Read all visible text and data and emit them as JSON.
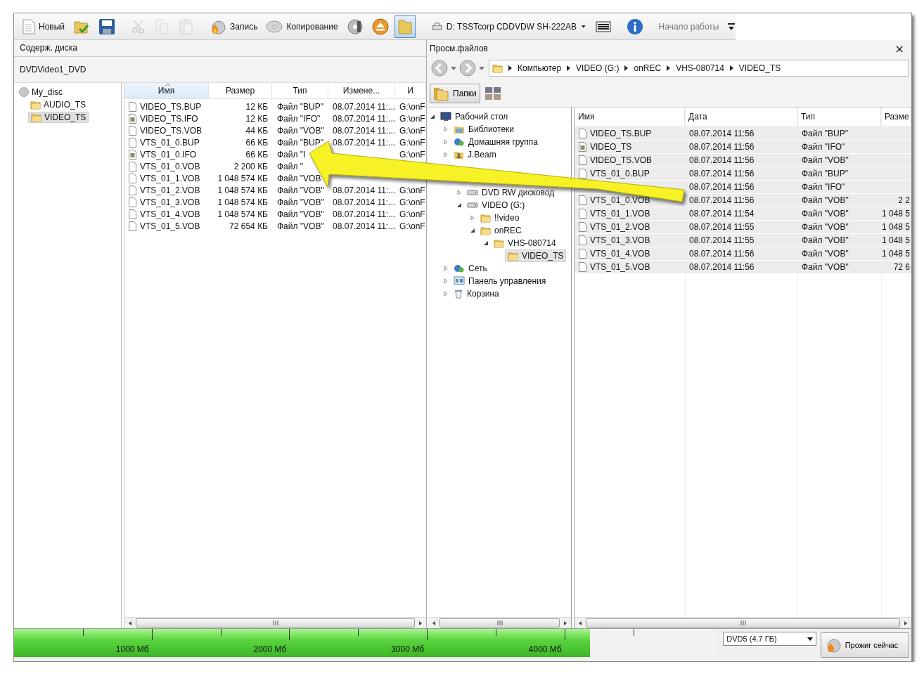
{
  "toolbar": {
    "items": [
      {
        "kind": "new",
        "label": "Новый",
        "disabled": false,
        "pressed": false
      },
      {
        "kind": "open",
        "disabled": false,
        "pressed": false
      },
      {
        "kind": "save",
        "disabled": false,
        "pressed": false
      },
      {
        "kind": "separator"
      },
      {
        "kind": "cut",
        "disabled": true,
        "pressed": false
      },
      {
        "kind": "copy",
        "disabled": true,
        "pressed": false
      },
      {
        "kind": "paste",
        "disabled": true,
        "pressed": false
      },
      {
        "kind": "separator"
      },
      {
        "kind": "burn",
        "label": "Запись",
        "disabled": false,
        "pressed": false
      },
      {
        "kind": "disc",
        "label": "Копирование",
        "disabled": false,
        "pressed": false
      },
      {
        "kind": "discinfo",
        "disabled": false,
        "pressed": false
      },
      {
        "kind": "eject",
        "disabled": false,
        "pressed": false
      },
      {
        "kind": "browser",
        "disabled": false,
        "pressed": true
      },
      {
        "kind": "separator"
      },
      {
        "kind": "drive",
        "label": "D: TSSTcorp CDDVDW SH-222AB"
      },
      {
        "kind": "list",
        "disabled": false,
        "pressed": false
      },
      {
        "kind": "separator"
      },
      {
        "kind": "info",
        "disabled": false,
        "pressed": false
      },
      {
        "kind": "separator"
      },
      {
        "kind": "start",
        "label": "Начало работы",
        "disabled": true,
        "pressed": false
      },
      {
        "kind": "overflow",
        "disabled": false,
        "pressed": false
      }
    ]
  },
  "disc_pane": {
    "title": "Содерж. диска",
    "project": "DVDVideo1_DVD",
    "tree": [
      {
        "label": "My_disc",
        "kind": "disc",
        "selected": false,
        "children": [
          {
            "label": "AUDIO_TS",
            "kind": "folder",
            "selected": false
          },
          {
            "label": "VIDEO_TS",
            "kind": "folder",
            "selected": true
          }
        ]
      }
    ],
    "table": {
      "columns": [
        {
          "label": "Имя",
          "sorted": true
        },
        {
          "label": "Размер",
          "sorted": false
        },
        {
          "label": "Тип",
          "sorted": false
        },
        {
          "label": "Измене...",
          "sorted": false
        },
        {
          "label": "И",
          "sorted": false
        }
      ],
      "rows": [
        {
          "kind": "file",
          "name": "VIDEO_TS.BUP",
          "size": "12 КБ",
          "type": "Файл \"BUP\"",
          "date": "08.07.2014 11:...",
          "path": "G:\\onF"
        },
        {
          "kind": "ifo",
          "name": "VIDEO_TS.IFO",
          "size": "12 КБ",
          "type": "Файл \"IFO\"",
          "date": "08.07.2014 11:...",
          "path": "G:\\onF"
        },
        {
          "kind": "file",
          "name": "VIDEO_TS.VOB",
          "size": "44 КБ",
          "type": "Файл \"VOB\"",
          "date": "08.07.2014 11:...",
          "path": "G:\\onF"
        },
        {
          "kind": "file",
          "name": "VTS_01_0.BUP",
          "size": "66 КБ",
          "type": "Файл \"BUP\"",
          "date": "08.07.2014 11:...",
          "path": "G:\\onF"
        },
        {
          "kind": "ifo",
          "name": "VTS_01_0.IFO",
          "size": "66 КБ",
          "type": "Файл \"I",
          "path": "G:\\onF"
        },
        {
          "kind": "file",
          "name": "VTS_01_0.VOB",
          "size": "2 200 КБ",
          "type": "Файл \""
        },
        {
          "kind": "file",
          "name": "VTS_01_1.VOB",
          "size": "1 048 574 КБ",
          "type": "Файл \"VOB"
        },
        {
          "kind": "file",
          "name": "VTS_01_2.VOB",
          "size": "1 048 574 КБ",
          "type": "Файл \"VOB\"",
          "date": "08.07.2014 11:...",
          "path": "G:\\onF"
        },
        {
          "kind": "file",
          "name": "VTS_01_3.VOB",
          "size": "1 048 574 КБ",
          "type": "Файл \"VOB\"",
          "date": "08.07.2014 11:...",
          "path": "G:\\onF"
        },
        {
          "kind": "file",
          "name": "VTS_01_4.VOB",
          "size": "1 048 574 КБ",
          "type": "Файл \"VOB\"",
          "date": "08.07.2014 11:...",
          "path": "G:\\onF"
        },
        {
          "kind": "file",
          "name": "VTS_01_5.VOB",
          "size": "72 654 КБ",
          "type": "Файл \"VOB\"",
          "date": "08.07.2014 11:...",
          "path": "G:\\onF"
        }
      ]
    }
  },
  "browser": {
    "title": "Просм.файлов",
    "close": "×",
    "path": [
      "Компьютер",
      "VIDEO (G:)",
      "onREC",
      "VHS-080714",
      "VIDEO_TS"
    ],
    "folders_button": {
      "label": "Папки",
      "pressed": true
    },
    "tree": [
      {
        "label": "Рабочий стол",
        "kind": "desktop",
        "expanded": true,
        "selected": false,
        "children": [
          {
            "label": "Библиотеки",
            "kind": "library",
            "expanded": false,
            "selected": false
          },
          {
            "label": "Домашняя группа",
            "kind": "network",
            "expanded": false,
            "selected": false
          },
          {
            "label": "J.Beam",
            "kind": "user",
            "expanded": false,
            "selected": false
          },
          {
            "kind": "hidden",
            "children": [
              {
                "kind": "hidden"
              },
              {
                "label": "DVD RW дисковод",
                "kind": "drive",
                "expanded": false,
                "selected": false
              },
              {
                "label": "VIDEO (G:)",
                "kind": "drive",
                "expanded": true,
                "selected": false,
                "children": [
                  {
                    "label": "!!video",
                    "kind": "folder",
                    "expanded": false,
                    "selected": false
                  },
                  {
                    "label": "onREC",
                    "kind": "folder",
                    "expanded": true,
                    "selected": false,
                    "children": [
                      {
                        "label": "VHS-080714",
                        "kind": "folder",
                        "expanded": true,
                        "selected": false,
                        "children": [
                          {
                            "label": "VIDEO_TS",
                            "kind": "folder",
                            "selected": true
                          }
                        ]
                      }
                    ]
                  }
                ]
              }
            ]
          },
          {
            "label": "Сеть",
            "kind": "network",
            "expanded": false,
            "selected": false
          },
          {
            "label": "Панель управления",
            "kind": "panel",
            "expanded": false,
            "selected": false
          },
          {
            "label": "Корзина",
            "kind": "bin",
            "expanded": false,
            "selected": false
          }
        ]
      }
    ],
    "table": {
      "columns": [
        "Имя",
        "Дата",
        "Тип",
        "Разме"
      ],
      "rows": [
        {
          "kind": "file",
          "name": "VIDEO_TS.BUP",
          "date": "08.07.2014 11:56",
          "type": "Файл \"BUP\"",
          "selected": true
        },
        {
          "kind": "ifo",
          "name": "VIDEO_TS",
          "date": "08.07.2014 11:56",
          "type": "Файл \"IFO\"",
          "selected": true
        },
        {
          "kind": "file",
          "name": "VIDEO_TS.VOB",
          "date": "08.07.2014 11:56",
          "type": "Файл \"VOB\"",
          "selected": true
        },
        {
          "kind": "file",
          "name": "VTS_01_0.BUP",
          "date": "08.07.2014 11:56",
          "type": "Файл \"BUP\"",
          "selected": true
        },
        {
          "kind": "hidden",
          "date": "08.07.2014 11:56",
          "type": "Файл \"IFO\"",
          "selected": true
        },
        {
          "kind": "file",
          "name": "VTS_01_0.VOB",
          "date": "08.07.2014 11:56",
          "type": "Файл \"VOB\"",
          "size": "2 2",
          "selected": true
        },
        {
          "kind": "file",
          "name": "VTS_01_1.VOB",
          "date": "08.07.2014 11:54",
          "type": "Файл \"VOB\"",
          "size": "1 048 5",
          "selected": true
        },
        {
          "kind": "file",
          "name": "VTS_01_2.VOB",
          "date": "08.07.2014 11:55",
          "type": "Файл \"VOB\"",
          "size": "1 048 5",
          "selected": true
        },
        {
          "kind": "file",
          "name": "VTS_01_3.VOB",
          "date": "08.07.2014 11:55",
          "type": "Файл \"VOB\"",
          "size": "1 048 5",
          "selected": true
        },
        {
          "kind": "file",
          "name": "VTS_01_4.VOB",
          "date": "08.07.2014 11:56",
          "type": "Файл \"VOB\"",
          "size": "1 048 5",
          "selected": true
        },
        {
          "kind": "file",
          "name": "VTS_01_5.VOB",
          "date": "08.07.2014 11:56",
          "type": "Файл \"VOB\"",
          "size": "72 6",
          "selected": true
        }
      ]
    }
  },
  "burn_bar": {
    "level": 0.82,
    "ticks": [
      "1000 Мб",
      "2000 Мб",
      "3000 Мб",
      "4000 Мб"
    ],
    "disc_type": "DVD5 (4.7 ГБ)",
    "burn_button": "Прожиг сейчас"
  }
}
